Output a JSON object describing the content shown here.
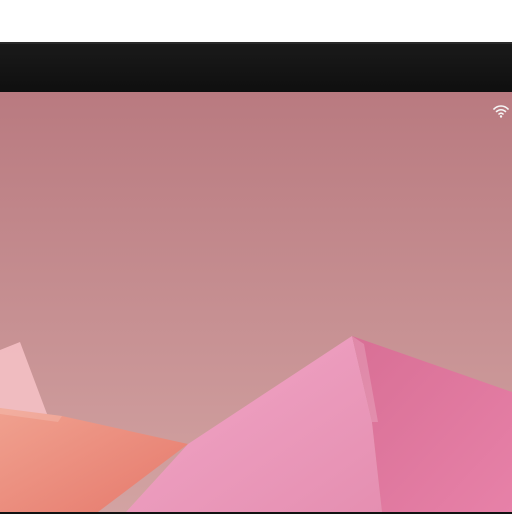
{
  "device": {
    "frame_color": "#121212",
    "bezel_color": "#0f0f0f"
  },
  "screen": {
    "wallpaper": {
      "colors": {
        "background": "#c98589",
        "paper_pink": "#e79aba",
        "paper_pink_dark": "#d86f95",
        "paper_coral": "#ef8a7f",
        "paper_highlight": "#f4c0c4"
      }
    }
  },
  "status_bar": {
    "icons": [
      "wifi-icon"
    ]
  }
}
